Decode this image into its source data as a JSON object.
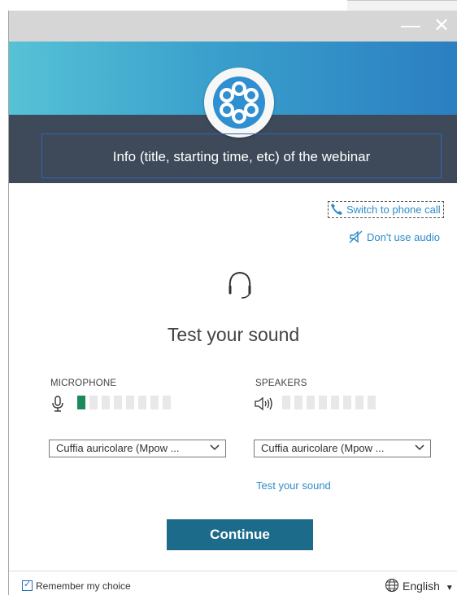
{
  "window": {
    "minimize_glyph": "—",
    "close_glyph": "✕"
  },
  "header": {
    "logo_icon": "flower-logo-icon",
    "info_text": "Info (title, starting time, etc) of the webinar"
  },
  "links": {
    "switch_phone": "Switch to phone call",
    "no_audio": "Don't use audio"
  },
  "main": {
    "headset_icon": "headset-icon",
    "title": "Test your sound",
    "microphone_label": "MICROPHONE",
    "speakers_label": "SPEAKERS",
    "microphone_level_segments_on": 1,
    "level_segments_total": 8,
    "microphone_device": "Cuffia auricolare (Mpow ...",
    "speakers_device": "Cuffia auricolare (Mpow ...",
    "test_sound_link": "Test your sound",
    "continue_label": "Continue"
  },
  "footer": {
    "remember_label": "Remember my choice",
    "remember_checked": true,
    "language": "English"
  },
  "colors": {
    "accent": "#2d8bc9",
    "button": "#1d6b8a",
    "meter_on": "#1b8a5a"
  }
}
